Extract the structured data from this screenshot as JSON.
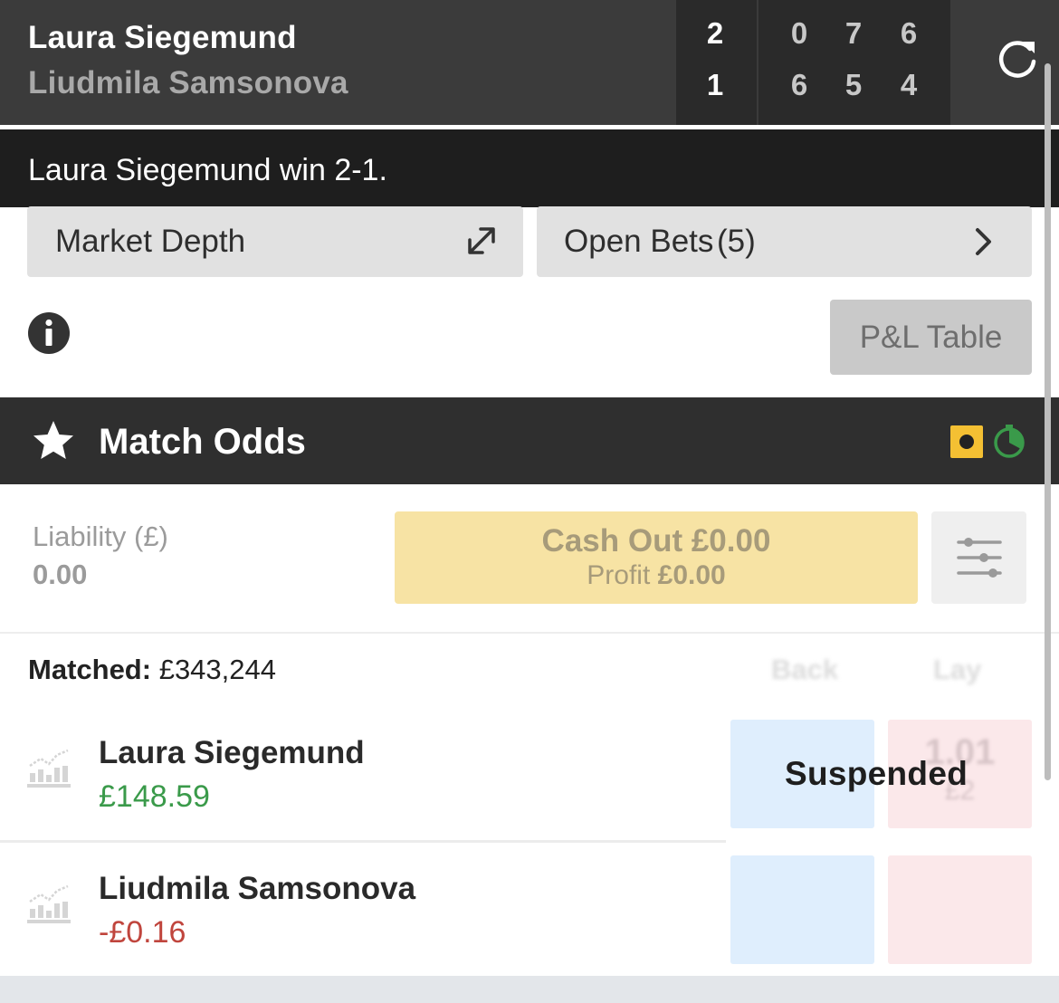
{
  "scoreboard": {
    "player1": "Laura Siegemund",
    "player2": "Liudmila Samsonova",
    "sets": [
      "2",
      "1"
    ],
    "games": [
      [
        "0",
        "7",
        "6"
      ],
      [
        "6",
        "5",
        "4"
      ]
    ]
  },
  "banner": {
    "text": "Laura Siegemund win 2-1."
  },
  "buttons": {
    "market_depth": "Market Depth",
    "open_bets": "Open Bets",
    "open_bets_count": "(5)",
    "pl_table": "P&L Table"
  },
  "market": {
    "title": "Match Odds"
  },
  "liability": {
    "label": "Liability (£)",
    "value": "0.00"
  },
  "cashout": {
    "title": "Cash Out £0.00",
    "profit_label": "Profit",
    "profit_value": "£0.00"
  },
  "matched": {
    "label": "Matched:",
    "value": "£343,244"
  },
  "columns": {
    "back": "Back",
    "lay": "Lay"
  },
  "runners": [
    {
      "name": "Laura Siegemund",
      "pl": "£148.59",
      "lay_price": "1.01",
      "lay_size": "£2"
    },
    {
      "name": "Liudmila Samsonova",
      "pl": "-£0.16"
    }
  ],
  "status": {
    "suspended": "Suspended"
  },
  "icons": {
    "refresh": "refresh-icon",
    "expand": "expand-icon",
    "chevron": "chevron-right-icon",
    "info": "info-icon",
    "star": "star-icon",
    "inplay": "inplay-icon",
    "timer": "timer-icon",
    "sliders": "sliders-icon",
    "chart": "chart-icon"
  },
  "colors": {
    "header_bg": "#3b3b3b",
    "banner_bg": "#1e1e1e",
    "cashout_bg": "#f7e3a4",
    "profit_green": "#3a9a4a",
    "loss_red": "#c0453d",
    "back_blue": "#dfeefd",
    "lay_pink": "#fbe8ea",
    "inplay_yellow": "#f4c033"
  }
}
